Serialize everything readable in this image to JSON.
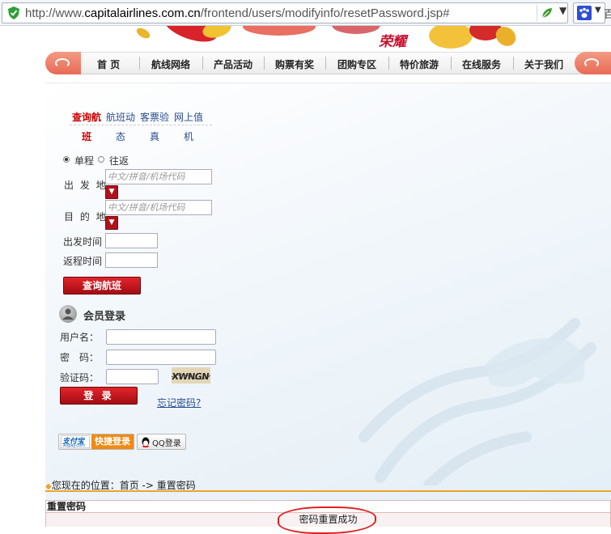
{
  "browser": {
    "url_prefix": "http://www.",
    "url_host": "capitalairlines.com.cn",
    "url_path": "/frontend/users/modifyinfo/resetPassword.jsp#",
    "right_text": "百"
  },
  "banner": {
    "honor_text": "荣耀"
  },
  "nav": {
    "items": [
      "首 页",
      "航线网络",
      "产品活动",
      "购票有奖",
      "团购专区",
      "特价旅游",
      "在线服务",
      "关于我们"
    ]
  },
  "tabs": [
    {
      "line1": "查询航",
      "line2": "班"
    },
    {
      "line1": "航班动",
      "line2": "态"
    },
    {
      "line1": "客票验",
      "line2": "真"
    },
    {
      "line1": "网上值",
      "line2": "机"
    }
  ],
  "search": {
    "trip_oneway": "单程",
    "trip_round": "往返",
    "from_label": "出 发 地",
    "to_label": "目 的 地",
    "city_placeholder": "中文/拼音/机场代码",
    "depart_label": "出发时间",
    "return_label": "返程时间",
    "submit": "查询航班"
  },
  "login": {
    "title": "会员登录",
    "username_label": "用户名：",
    "password_label": "密　码：",
    "captcha_label": "验证码：",
    "captcha_text": "XWNGN",
    "submit": "登 录",
    "forgot": "忘记密码?",
    "alipay_brand": "支付宝",
    "alipay_sub": "Alipay.com",
    "alipay_label": "快捷登录",
    "qq_label": "QQ登录"
  },
  "breadcrumb": {
    "prefix": "您现在的位置：",
    "home": "首页",
    "arrow": " -> ",
    "current": "重置密码"
  },
  "result": {
    "heading": "重置密码",
    "message": "密码重置成功"
  },
  "colors": {
    "accent_red": "#c00000",
    "link_blue": "#2a4d8f",
    "orange_rule": "#f0a12b",
    "annotation_red": "#e0201f"
  }
}
